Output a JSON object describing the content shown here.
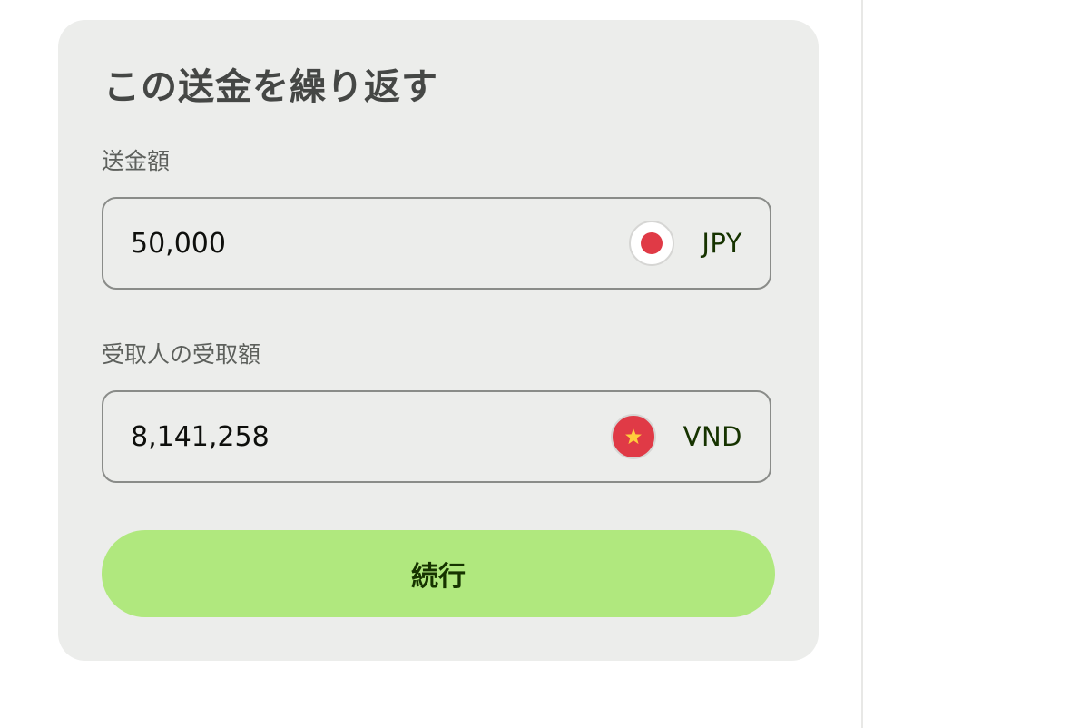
{
  "card": {
    "title": "この送金を繰り返す"
  },
  "send": {
    "label": "送金額",
    "amount": "50,000",
    "currency_code": "JPY",
    "flag_icon": "japan-flag-icon"
  },
  "receive": {
    "label": "受取人の受取額",
    "amount": "8,141,258",
    "currency_code": "VND",
    "flag_icon": "vietnam-flag-icon"
  },
  "actions": {
    "continue_label": "続行"
  },
  "colors": {
    "card_background": "#ecedeb",
    "button_background": "#b0e87e",
    "button_text": "#163300",
    "flag_red": "#e03a46",
    "flag_star": "#ffcd3c"
  }
}
